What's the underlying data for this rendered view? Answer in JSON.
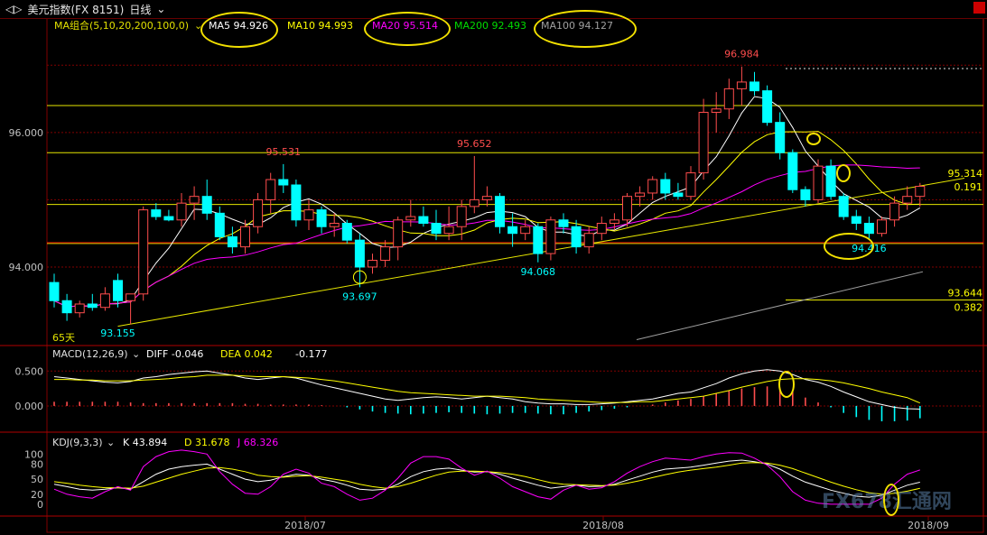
{
  "window": {
    "back_glyph": "◁▷",
    "title": "美元指数(FX 8151)",
    "period": "日线",
    "dropdown": "⌄"
  },
  "legend_main": {
    "label": "MA组合(5,10,20,200,100,0)",
    "dropdown": "⌄",
    "items": [
      {
        "text": "MA5 94.926",
        "color": "#ffffff"
      },
      {
        "text": "MA10 94.993",
        "color": "#ffff00"
      },
      {
        "text": "MA20 95.514",
        "color": "#ff00ff"
      },
      {
        "text": "MA200 92.493",
        "color": "#00dd00"
      },
      {
        "text": "MA100 94.127",
        "color": "#a0a0a0"
      }
    ]
  },
  "legend_macd": {
    "label": "MACD(12,26,9)",
    "dropdown": "⌄",
    "diff": "DIFF -0.046",
    "dea": "DEA 0.042",
    "macd": "-0.177"
  },
  "legend_kdj": {
    "label": "KDJ(9,3,3)",
    "dropdown": "⌄",
    "k": "K 43.894",
    "d": "D 31.678",
    "j": "J 68.326"
  },
  "watermark": "FX678汇通网",
  "colors": {
    "up": "#ff4d4d",
    "down": "#00ffff",
    "grid": "#800000",
    "axis_text": "#c0c0c0"
  },
  "chart_data": {
    "type": "candlestick",
    "x_labels": [
      "2018/07",
      "2018/08",
      "2018/09"
    ],
    "price_axis": {
      "ticks": [
        94.0,
        96.0
      ],
      "tick_labels": [
        "94.000",
        "96.000"
      ],
      "range": [
        92.9,
        97.5
      ]
    },
    "annotations": [
      {
        "text": "96.984",
        "value": 96.984
      },
      {
        "text": "95.531",
        "value": 95.531
      },
      {
        "text": "95.652",
        "value": 95.652
      },
      {
        "text": "93.697",
        "value": 93.697
      },
      {
        "text": "94.068",
        "value": 94.068
      },
      {
        "text": "94.416",
        "value": 94.416
      },
      {
        "text": "93.155",
        "value": 93.155
      }
    ],
    "levels": [
      {
        "value": 95.314,
        "label": "95.314"
      },
      {
        "value": 93.644,
        "label": "93.644"
      }
    ],
    "fib_labels": [
      "0.191",
      "0.382"
    ],
    "days_label": "65天",
    "candles": [
      {
        "o": 93.77,
        "h": 93.9,
        "l": 93.4,
        "c": 93.5
      },
      {
        "o": 93.5,
        "h": 93.6,
        "l": 93.2,
        "c": 93.32
      },
      {
        "o": 93.32,
        "h": 93.5,
        "l": 93.25,
        "c": 93.45
      },
      {
        "o": 93.45,
        "h": 93.6,
        "l": 93.35,
        "c": 93.4
      },
      {
        "o": 93.4,
        "h": 93.7,
        "l": 93.35,
        "c": 93.6
      },
      {
        "o": 93.8,
        "h": 93.9,
        "l": 93.4,
        "c": 93.5
      },
      {
        "o": 93.5,
        "h": 93.6,
        "l": 93.15,
        "c": 93.6
      },
      {
        "o": 93.6,
        "h": 94.9,
        "l": 93.5,
        "c": 94.85
      },
      {
        "o": 94.85,
        "h": 94.95,
        "l": 94.7,
        "c": 94.75
      },
      {
        "o": 94.75,
        "h": 94.85,
        "l": 94.68,
        "c": 94.7
      },
      {
        "o": 94.7,
        "h": 95.1,
        "l": 94.6,
        "c": 94.95
      },
      {
        "o": 94.95,
        "h": 95.2,
        "l": 94.7,
        "c": 95.05
      },
      {
        "o": 95.05,
        "h": 95.3,
        "l": 94.7,
        "c": 94.8
      },
      {
        "o": 94.8,
        "h": 94.9,
        "l": 94.4,
        "c": 94.45
      },
      {
        "o": 94.45,
        "h": 94.6,
        "l": 94.2,
        "c": 94.3
      },
      {
        "o": 94.3,
        "h": 94.7,
        "l": 94.2,
        "c": 94.6
      },
      {
        "o": 94.6,
        "h": 95.1,
        "l": 94.5,
        "c": 95.0
      },
      {
        "o": 95.0,
        "h": 95.4,
        "l": 94.8,
        "c": 95.3
      },
      {
        "o": 95.3,
        "h": 95.53,
        "l": 95.1,
        "c": 95.22
      },
      {
        "o": 95.22,
        "h": 95.3,
        "l": 94.6,
        "c": 94.7
      },
      {
        "o": 94.7,
        "h": 95.0,
        "l": 94.55,
        "c": 94.85
      },
      {
        "o": 94.85,
        "h": 94.9,
        "l": 94.5,
        "c": 94.6
      },
      {
        "o": 94.6,
        "h": 94.8,
        "l": 94.45,
        "c": 94.65
      },
      {
        "o": 94.65,
        "h": 94.7,
        "l": 94.35,
        "c": 94.4
      },
      {
        "o": 94.4,
        "h": 94.5,
        "l": 93.7,
        "c": 94.0
      },
      {
        "o": 94.0,
        "h": 94.2,
        "l": 93.9,
        "c": 94.1
      },
      {
        "o": 94.1,
        "h": 94.4,
        "l": 94.0,
        "c": 94.3
      },
      {
        "o": 94.3,
        "h": 94.75,
        "l": 94.1,
        "c": 94.7
      },
      {
        "o": 94.7,
        "h": 95.0,
        "l": 94.6,
        "c": 94.75
      },
      {
        "o": 94.75,
        "h": 94.9,
        "l": 94.6,
        "c": 94.65
      },
      {
        "o": 94.65,
        "h": 94.85,
        "l": 94.4,
        "c": 94.5
      },
      {
        "o": 94.5,
        "h": 94.9,
        "l": 94.4,
        "c": 94.6
      },
      {
        "o": 94.6,
        "h": 95.0,
        "l": 94.4,
        "c": 94.9
      },
      {
        "o": 94.9,
        "h": 95.65,
        "l": 94.8,
        "c": 95.0
      },
      {
        "o": 95.0,
        "h": 95.2,
        "l": 94.9,
        "c": 95.05
      },
      {
        "o": 95.05,
        "h": 95.1,
        "l": 94.5,
        "c": 94.6
      },
      {
        "o": 94.6,
        "h": 94.8,
        "l": 94.3,
        "c": 94.5
      },
      {
        "o": 94.5,
        "h": 94.7,
        "l": 94.4,
        "c": 94.6
      },
      {
        "o": 94.6,
        "h": 94.65,
        "l": 94.07,
        "c": 94.2
      },
      {
        "o": 94.2,
        "h": 94.75,
        "l": 94.1,
        "c": 94.7
      },
      {
        "o": 94.7,
        "h": 94.8,
        "l": 94.5,
        "c": 94.6
      },
      {
        "o": 94.6,
        "h": 94.7,
        "l": 94.2,
        "c": 94.3
      },
      {
        "o": 94.3,
        "h": 94.6,
        "l": 94.2,
        "c": 94.5
      },
      {
        "o": 94.5,
        "h": 94.75,
        "l": 94.4,
        "c": 94.65
      },
      {
        "o": 94.65,
        "h": 94.8,
        "l": 94.55,
        "c": 94.7
      },
      {
        "o": 94.7,
        "h": 95.1,
        "l": 94.6,
        "c": 95.05
      },
      {
        "o": 95.05,
        "h": 95.2,
        "l": 94.9,
        "c": 95.1
      },
      {
        "o": 95.1,
        "h": 95.35,
        "l": 95.0,
        "c": 95.3
      },
      {
        "o": 95.3,
        "h": 95.4,
        "l": 95.0,
        "c": 95.1
      },
      {
        "o": 95.1,
        "h": 95.25,
        "l": 95.0,
        "c": 95.05
      },
      {
        "o": 95.05,
        "h": 95.5,
        "l": 95.0,
        "c": 95.4
      },
      {
        "o": 95.4,
        "h": 96.5,
        "l": 95.3,
        "c": 96.3
      },
      {
        "o": 96.3,
        "h": 96.6,
        "l": 96.0,
        "c": 96.35
      },
      {
        "o": 96.35,
        "h": 96.8,
        "l": 96.2,
        "c": 96.65
      },
      {
        "o": 96.65,
        "h": 96.98,
        "l": 96.4,
        "c": 96.75
      },
      {
        "o": 96.75,
        "h": 96.9,
        "l": 96.55,
        "c": 96.62
      },
      {
        "o": 96.62,
        "h": 96.7,
        "l": 96.1,
        "c": 96.15
      },
      {
        "o": 96.15,
        "h": 96.3,
        "l": 95.6,
        "c": 95.7
      },
      {
        "o": 95.7,
        "h": 95.75,
        "l": 95.1,
        "c": 95.15
      },
      {
        "o": 95.15,
        "h": 95.2,
        "l": 94.9,
        "c": 95.0
      },
      {
        "o": 95.0,
        "h": 95.6,
        "l": 94.95,
        "c": 95.5
      },
      {
        "o": 95.5,
        "h": 95.6,
        "l": 95.0,
        "c": 95.05
      },
      {
        "o": 95.05,
        "h": 95.1,
        "l": 94.7,
        "c": 94.75
      },
      {
        "o": 94.75,
        "h": 94.85,
        "l": 94.55,
        "c": 94.65
      },
      {
        "o": 94.65,
        "h": 94.75,
        "l": 94.42,
        "c": 94.5
      },
      {
        "o": 94.5,
        "h": 94.75,
        "l": 94.45,
        "c": 94.7
      },
      {
        "o": 94.7,
        "h": 95.05,
        "l": 94.6,
        "c": 94.95
      },
      {
        "o": 94.95,
        "h": 95.2,
        "l": 94.85,
        "c": 95.05
      },
      {
        "o": 95.05,
        "h": 95.25,
        "l": 94.9,
        "c": 95.2
      }
    ],
    "macd_axis": {
      "ticks": [
        0.5,
        0.0
      ],
      "tick_labels": [
        "0.500",
        "0.000"
      ],
      "range": [
        -0.35,
        0.62
      ]
    },
    "macd": {
      "diff": [
        0.42,
        0.4,
        0.38,
        0.36,
        0.34,
        0.33,
        0.35,
        0.4,
        0.42,
        0.45,
        0.47,
        0.49,
        0.5,
        0.47,
        0.44,
        0.4,
        0.38,
        0.4,
        0.42,
        0.4,
        0.35,
        0.3,
        0.26,
        0.22,
        0.18,
        0.14,
        0.1,
        0.08,
        0.1,
        0.12,
        0.13,
        0.12,
        0.1,
        0.12,
        0.14,
        0.12,
        0.1,
        0.06,
        0.04,
        0.03,
        0.03,
        0.02,
        0.02,
        0.03,
        0.04,
        0.06,
        0.08,
        0.1,
        0.14,
        0.18,
        0.2,
        0.26,
        0.32,
        0.4,
        0.46,
        0.5,
        0.52,
        0.5,
        0.45,
        0.38,
        0.34,
        0.28,
        0.2,
        0.13,
        0.06,
        0.02,
        -0.02,
        -0.04,
        -0.046
      ],
      "dea": [
        0.38,
        0.38,
        0.37,
        0.37,
        0.36,
        0.36,
        0.36,
        0.37,
        0.38,
        0.39,
        0.41,
        0.42,
        0.44,
        0.44,
        0.44,
        0.43,
        0.42,
        0.42,
        0.42,
        0.41,
        0.4,
        0.38,
        0.36,
        0.33,
        0.3,
        0.27,
        0.24,
        0.21,
        0.19,
        0.18,
        0.17,
        0.16,
        0.15,
        0.14,
        0.14,
        0.14,
        0.13,
        0.12,
        0.1,
        0.09,
        0.08,
        0.07,
        0.06,
        0.05,
        0.05,
        0.05,
        0.06,
        0.06,
        0.08,
        0.1,
        0.12,
        0.14,
        0.18,
        0.22,
        0.27,
        0.31,
        0.35,
        0.38,
        0.39,
        0.39,
        0.38,
        0.36,
        0.33,
        0.29,
        0.25,
        0.2,
        0.16,
        0.12,
        0.042
      ]
    },
    "kdj_axis": {
      "ticks": [
        100,
        80,
        50,
        20,
        0
      ],
      "tick_labels": [
        "100",
        "80",
        "50",
        "20",
        "0"
      ],
      "range": [
        -20,
        115
      ]
    },
    "kdj": {
      "k": [
        40,
        35,
        30,
        28,
        30,
        33,
        30,
        45,
        60,
        70,
        75,
        78,
        80,
        70,
        60,
        50,
        45,
        48,
        55,
        60,
        58,
        50,
        45,
        38,
        30,
        28,
        30,
        40,
        55,
        65,
        70,
        72,
        68,
        64,
        65,
        60,
        52,
        45,
        38,
        32,
        35,
        38,
        35,
        36,
        40,
        48,
        56,
        64,
        70,
        72,
        74,
        78,
        82,
        86,
        88,
        85,
        80,
        70,
        56,
        44,
        36,
        28,
        22,
        16,
        14,
        18,
        28,
        38,
        43.9
      ],
      "d": [
        45,
        42,
        38,
        35,
        33,
        33,
        32,
        36,
        44,
        52,
        60,
        66,
        72,
        73,
        70,
        65,
        58,
        55,
        54,
        56,
        57,
        54,
        50,
        46,
        40,
        35,
        32,
        35,
        42,
        50,
        58,
        64,
        66,
        66,
        65,
        63,
        60,
        55,
        49,
        43,
        40,
        39,
        38,
        37,
        38,
        42,
        47,
        53,
        59,
        64,
        68,
        71,
        74,
        78,
        82,
        83,
        82,
        78,
        71,
        62,
        53,
        44,
        36,
        29,
        23,
        20,
        22,
        26,
        31.7
      ],
      "j": [
        30,
        20,
        15,
        12,
        25,
        35,
        28,
        75,
        95,
        105,
        108,
        105,
        100,
        65,
        40,
        22,
        20,
        35,
        60,
        70,
        62,
        42,
        35,
        20,
        8,
        12,
        28,
        52,
        82,
        95,
        95,
        90,
        72,
        58,
        66,
        52,
        35,
        25,
        15,
        10,
        28,
        38,
        30,
        33,
        45,
        62,
        75,
        85,
        92,
        90,
        88,
        95,
        100,
        103,
        102,
        92,
        78,
        55,
        25,
        8,
        2,
        0,
        0,
        0,
        0,
        12,
        40,
        60,
        68.3
      ]
    },
    "macd_hist": [
      0.06,
      0.06,
      0.06,
      0.06,
      0.06,
      0.06,
      0.05,
      0.04,
      0.04,
      0.04,
      0.04,
      0.04,
      0.04,
      0.04,
      0.04,
      0.03,
      0.03,
      0.02,
      0.02,
      0.02,
      0.02,
      0.01,
      0.0,
      -0.02,
      -0.05,
      -0.08,
      -0.1,
      -0.11,
      -0.12,
      -0.11,
      -0.1,
      -0.09,
      -0.1,
      -0.11,
      -0.12,
      -0.11,
      -0.1,
      -0.1,
      -0.11,
      -0.12,
      -0.12,
      -0.1,
      -0.08,
      -0.06,
      -0.04,
      -0.02,
      0.0,
      0.02,
      0.05,
      0.08,
      0.1,
      0.14,
      0.18,
      0.22,
      0.25,
      0.27,
      0.28,
      0.26,
      0.2,
      0.12,
      0.05,
      -0.02,
      -0.1,
      -0.16,
      -0.2,
      -0.22,
      -0.22,
      -0.21,
      -0.177
    ]
  }
}
